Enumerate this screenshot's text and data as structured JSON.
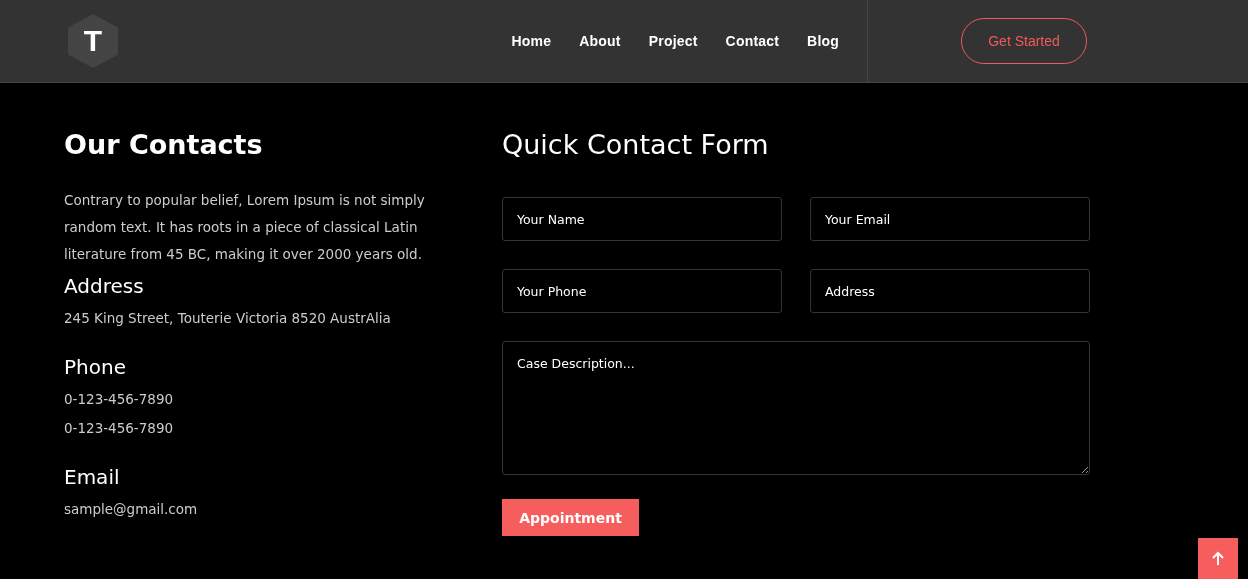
{
  "header": {
    "logo": {
      "letter": "T"
    },
    "nav": [
      {
        "label": "Home"
      },
      {
        "label": "About"
      },
      {
        "label": "Project"
      },
      {
        "label": "Contact"
      },
      {
        "label": "Blog"
      }
    ],
    "cta": "Get Started"
  },
  "contacts": {
    "title": "Our Contacts",
    "intro": "Contrary to popular belief, Lorem Ipsum is not simply random text. It has roots in a piece of classical Latin literature from 45 BC, making it over 2000 years old.",
    "sections": [
      {
        "heading": "Address",
        "lines": [
          "245 King Street, Touterie Victoria 8520 AustrAlia"
        ]
      },
      {
        "heading": "Phone",
        "lines": [
          "0-123-456-7890",
          "0-123-456-7890"
        ]
      },
      {
        "heading": "Email",
        "lines": [
          "sample@gmail.com"
        ]
      }
    ]
  },
  "form": {
    "title": "Quick Contact Form",
    "fields": [
      {
        "kind": "input",
        "placeholder": "Your Name"
      },
      {
        "kind": "input",
        "placeholder": "Your Email"
      },
      {
        "kind": "input",
        "placeholder": "Your Phone"
      },
      {
        "kind": "input",
        "placeholder": "Address"
      },
      {
        "kind": "textarea",
        "placeholder": "Case Description..."
      }
    ],
    "submit": "Appointment"
  }
}
